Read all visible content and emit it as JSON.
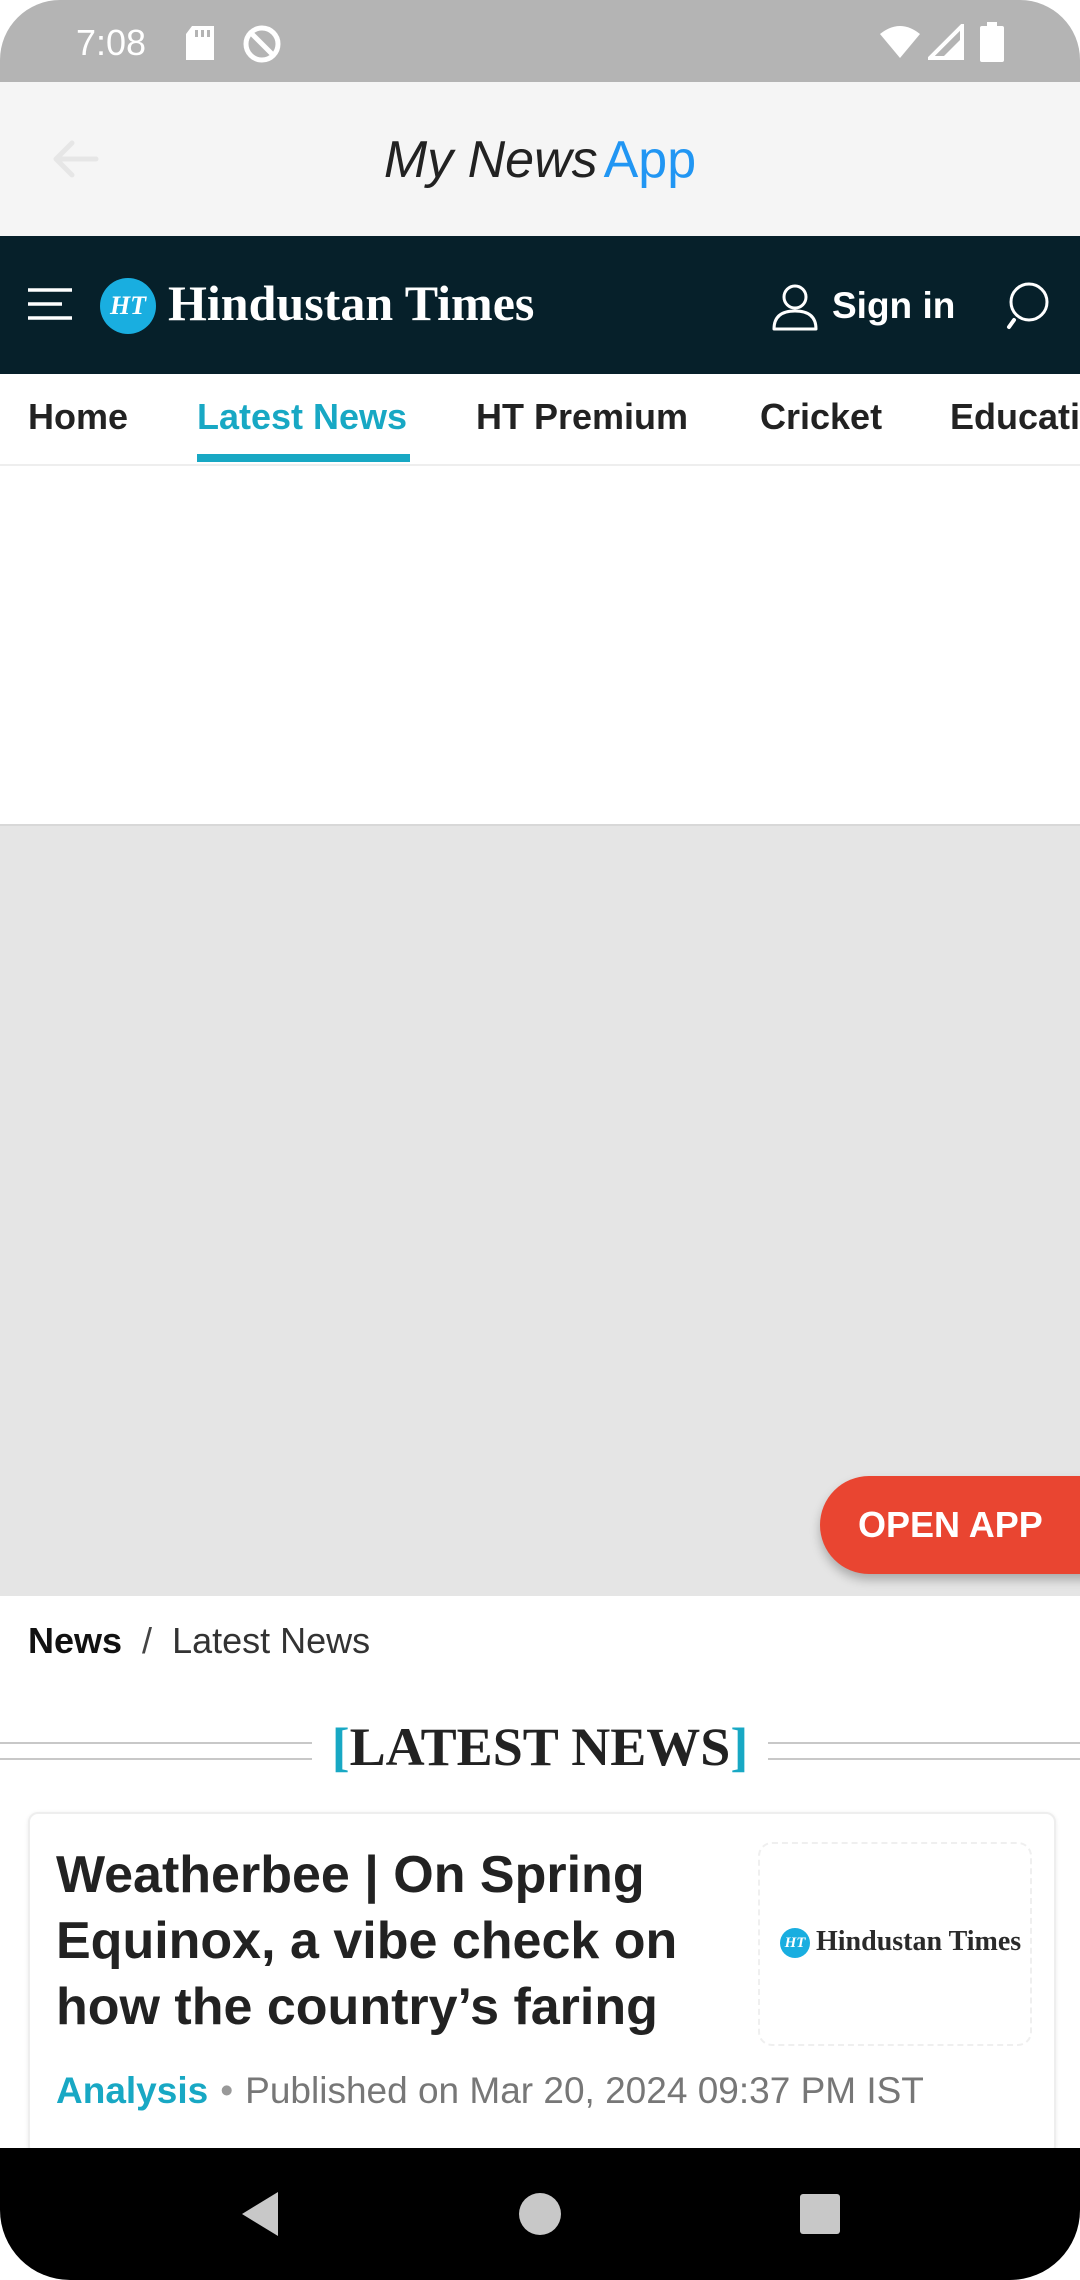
{
  "status_bar": {
    "time": "7:08",
    "icons": [
      "sd-card-icon",
      "sync-icon",
      "wifi-icon",
      "signal-icon",
      "battery-icon"
    ]
  },
  "app_bar": {
    "title_main": "My News",
    "title_accent": "App",
    "accent_color": "#2196f3"
  },
  "site_header": {
    "logo_mark": "HT",
    "logo_text": "Hindustan Times",
    "signin_label": "Sign in",
    "brand_color": "#06202a",
    "accent_color": "#18a8c4"
  },
  "tabs": [
    {
      "label": "Home"
    },
    {
      "label": "Latest News"
    },
    {
      "label": "HT Premium"
    },
    {
      "label": "Cricket"
    },
    {
      "label": "Educati"
    }
  ],
  "open_app": {
    "label": "OPEN APP",
    "color": "#e94531"
  },
  "breadcrumb": {
    "parent": "News",
    "separator": "/",
    "current": "Latest News"
  },
  "section": {
    "open_bracket": "[",
    "title": "LATEST NEWS",
    "close_bracket": "]"
  },
  "article": {
    "title": "Weatherbee | On Spring Equinox, a vibe check on how the country’s faring",
    "thumb_mark": "HT",
    "thumb_text": "Hindustan Times",
    "tag": "Analysis",
    "separator": "•",
    "published": "Published on Mar 20, 2024 09:37 PM IST"
  }
}
